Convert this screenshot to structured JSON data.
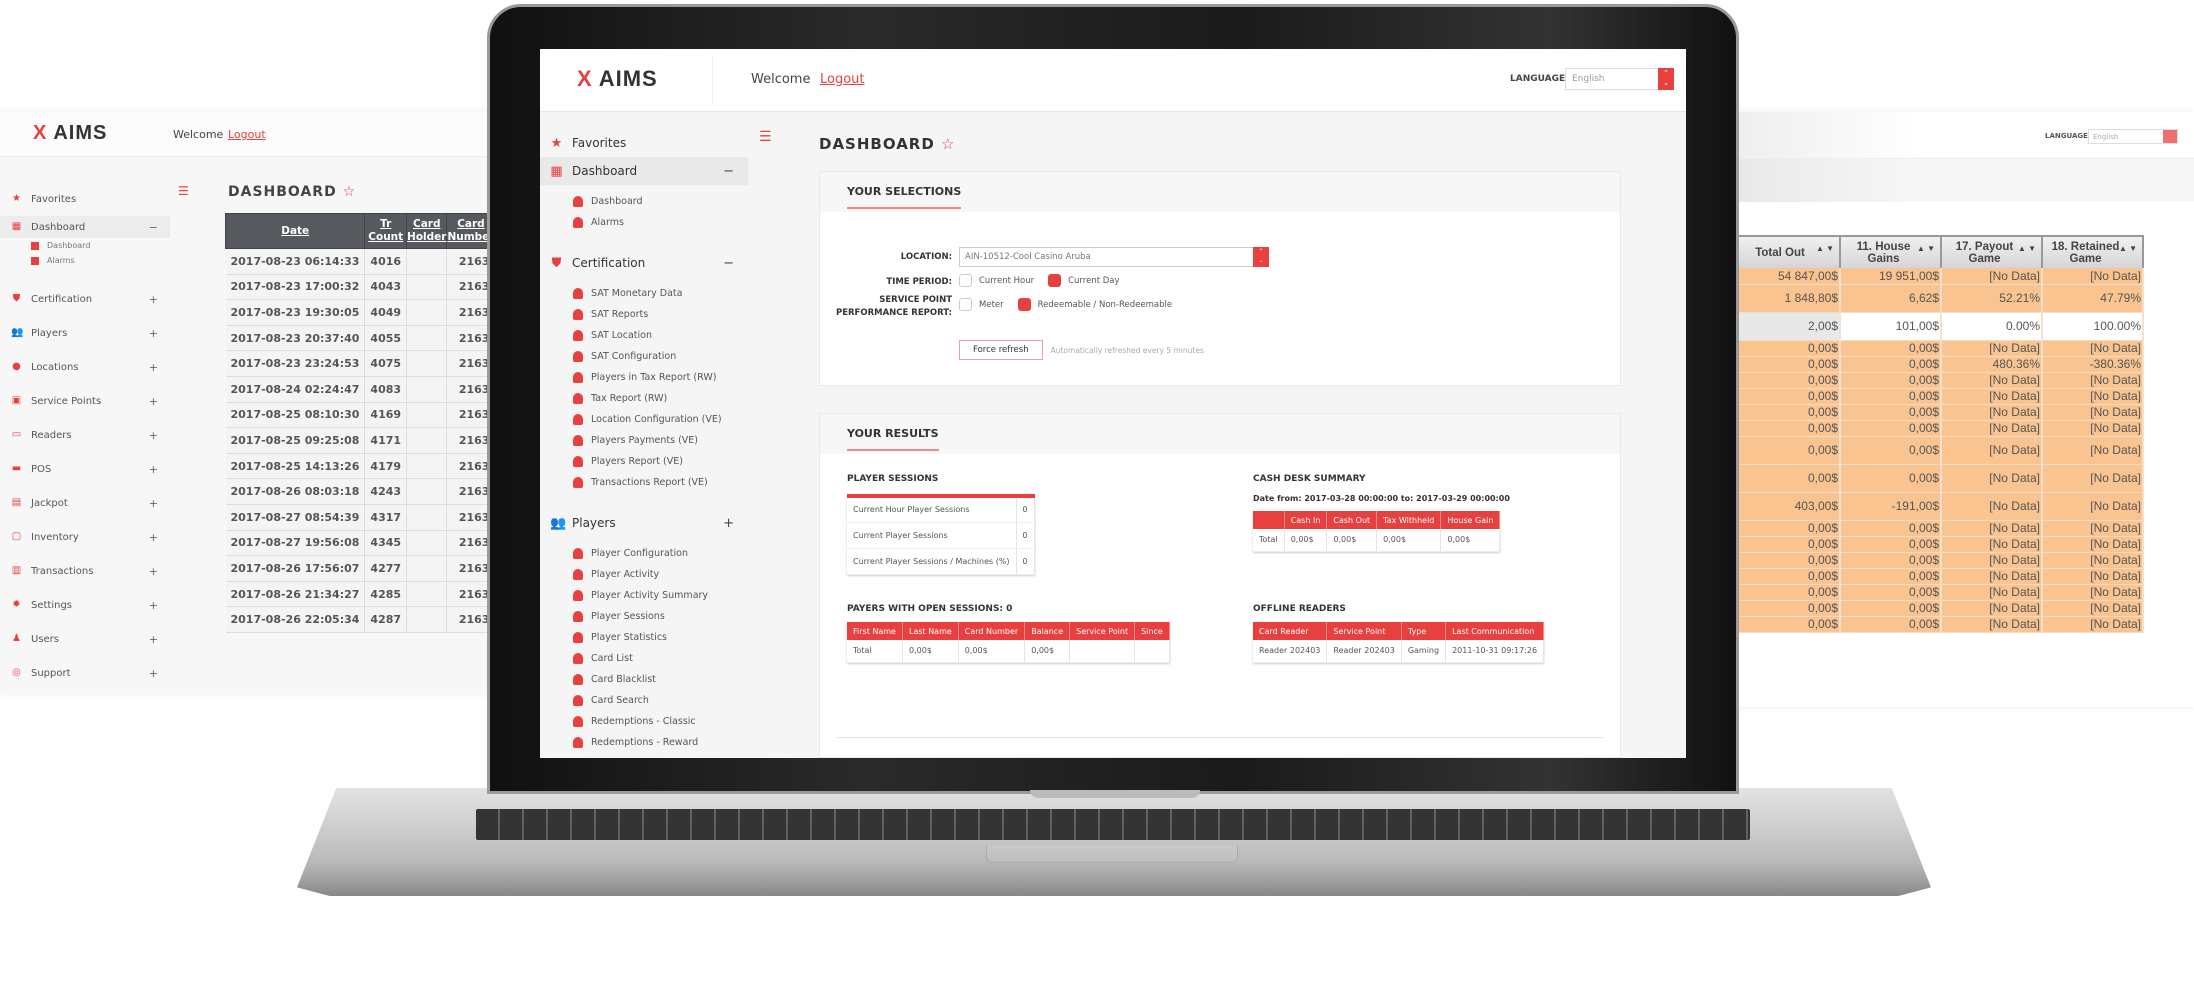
{
  "colors": {
    "accent": "#e8403f",
    "table_header_dark": "#565a5e",
    "row_highlight": "#f9c48f"
  },
  "brand": {
    "logo_mark": "X",
    "logo_text": "AIMS"
  },
  "header": {
    "welcome": "Welcome",
    "logout": "Logout",
    "language_label": "LANGUAGE",
    "language_value": "English"
  },
  "left_panel": {
    "sidebar": [
      {
        "label": "Favorites",
        "icon": "star-icon",
        "glyph": "★",
        "toggle": ""
      },
      {
        "label": "Dashboard",
        "icon": "dashboard-icon",
        "glyph": "▦",
        "toggle": "−",
        "active": true,
        "children": [
          "Dashboard",
          "Alarms"
        ]
      },
      {
        "label": "Certification",
        "icon": "shield-icon",
        "glyph": "⛊",
        "toggle": "+"
      },
      {
        "label": "Players",
        "icon": "players-icon",
        "glyph": "👥",
        "toggle": "+"
      },
      {
        "label": "Locations",
        "icon": "map-pin-icon",
        "glyph": "●",
        "toggle": "+"
      },
      {
        "label": "Service Points",
        "icon": "service-point-icon",
        "glyph": "▣",
        "toggle": "+"
      },
      {
        "label": "Readers",
        "icon": "card-reader-icon",
        "glyph": "▭",
        "toggle": "+"
      },
      {
        "label": "POS",
        "icon": "pos-icon",
        "glyph": "▬",
        "toggle": "+"
      },
      {
        "label": "Jackpot",
        "icon": "jackpot-icon",
        "glyph": "▤",
        "toggle": "+"
      },
      {
        "label": "Inventory",
        "icon": "clipboard-icon",
        "glyph": "▢",
        "toggle": "+"
      },
      {
        "label": "Transactions",
        "icon": "book-icon",
        "glyph": "▥",
        "toggle": "+"
      },
      {
        "label": "Settings",
        "icon": "gear-icon",
        "glyph": "✹",
        "toggle": "+"
      },
      {
        "label": "Users",
        "icon": "users-icon",
        "glyph": "♟",
        "toggle": "+"
      },
      {
        "label": "Support",
        "icon": "headset-icon",
        "glyph": "◎",
        "toggle": "+"
      }
    ],
    "title": "DASHBOARD",
    "table": {
      "columns": [
        "Date",
        "Tr Count",
        "Card Holder",
        "Card Number"
      ],
      "rows": [
        [
          "2017-08-23 06:14:33",
          "4016",
          "",
          "2163"
        ],
        [
          "2017-08-23 17:00:32",
          "4043",
          "",
          "2163"
        ],
        [
          "2017-08-23 19:30:05",
          "4049",
          "",
          "2163"
        ],
        [
          "2017-08-23 20:37:40",
          "4055",
          "",
          "2163"
        ],
        [
          "2017-08-23 23:24:53",
          "4075",
          "",
          "2163"
        ],
        [
          "2017-08-24 02:24:47",
          "4083",
          "",
          "2163"
        ],
        [
          "2017-08-25 08:10:30",
          "4169",
          "",
          "2163"
        ],
        [
          "2017-08-25 09:25:08",
          "4171",
          "",
          "2163"
        ],
        [
          "2017-08-25 14:13:26",
          "4179",
          "",
          "2163"
        ],
        [
          "2017-08-26 08:03:18",
          "4243",
          "",
          "2163"
        ],
        [
          "2017-08-27 08:54:39",
          "4317",
          "",
          "2163"
        ],
        [
          "2017-08-27 19:56:08",
          "4345",
          "",
          "2163"
        ],
        [
          "2017-08-26 17:56:07",
          "4277",
          "",
          "2163"
        ],
        [
          "2017-08-26 21:34:27",
          "4285",
          "",
          "2163"
        ],
        [
          "2017-08-26 22:05:34",
          "4287",
          "",
          "2163"
        ]
      ]
    }
  },
  "right_panel": {
    "table": {
      "columns": [
        "Total Out",
        "11. House Gains",
        "17. Payout Game",
        "18. Retained Game"
      ],
      "rows": [
        [
          "54 847,00$",
          "19 951,00$",
          "[No Data]",
          "[No Data]"
        ],
        [
          "1 848,80$",
          "6,62$",
          "52.21%",
          "47.79%"
        ],
        [
          "2,00$",
          "101,00$",
          "0.00%",
          "100.00%"
        ],
        [
          "0,00$",
          "0,00$",
          "[No Data]",
          "[No Data]"
        ],
        [
          "0,00$",
          "0,00$",
          "480.36%",
          "-380.36%"
        ],
        [
          "0,00$",
          "0,00$",
          "[No Data]",
          "[No Data]"
        ],
        [
          "0,00$",
          "0,00$",
          "[No Data]",
          "[No Data]"
        ],
        [
          "0,00$",
          "0,00$",
          "[No Data]",
          "[No Data]"
        ],
        [
          "0,00$",
          "0,00$",
          "[No Data]",
          "[No Data]"
        ],
        [
          "0,00$",
          "0,00$",
          "[No Data]",
          "[No Data]"
        ],
        [
          "0,00$",
          "0,00$",
          "[No Data]",
          "[No Data]"
        ],
        [
          "403,00$",
          "-191,00$",
          "[No Data]",
          "[No Data]"
        ],
        [
          "0,00$",
          "0,00$",
          "[No Data]",
          "[No Data]"
        ],
        [
          "0,00$",
          "0,00$",
          "[No Data]",
          "[No Data]"
        ],
        [
          "0,00$",
          "0,00$",
          "[No Data]",
          "[No Data]"
        ],
        [
          "0,00$",
          "0,00$",
          "[No Data]",
          "[No Data]"
        ],
        [
          "0,00$",
          "0,00$",
          "[No Data]",
          "[No Data]"
        ],
        [
          "0,00$",
          "0,00$",
          "[No Data]",
          "[No Data]"
        ],
        [
          "0,00$",
          "0,00$",
          "[No Data]",
          "[No Data]"
        ]
      ]
    }
  },
  "screen": {
    "sidebar": [
      {
        "label": "Favorites",
        "icon": "star-icon",
        "glyph": "★",
        "toggle": "",
        "children": []
      },
      {
        "label": "Dashboard",
        "icon": "dashboard-icon",
        "glyph": "▦",
        "toggle": "−",
        "active": true,
        "children": [
          "Dashboard",
          "Alarms"
        ]
      },
      {
        "label": "Certification",
        "icon": "shield-icon",
        "glyph": "⛊",
        "toggle": "−",
        "children": [
          "SAT Monetary Data",
          "SAT Reports",
          "SAT Location",
          "SAT Configuration",
          "Players in Tax Report (RW)",
          "Tax Report (RW)",
          "Location Configuration (VE)",
          "Players Payments (VE)",
          "Players Report (VE)",
          "Transactions Report (VE)"
        ]
      },
      {
        "label": "Players",
        "icon": "players-icon",
        "glyph": "👥",
        "toggle": "+",
        "children": [
          "Player Configuration",
          "Player Activity",
          "Player Activity Summary",
          "Player Sessions",
          "Player Statistics",
          "Card List",
          "Card Blacklist",
          "Card Search",
          "Redemptions - Classic",
          "Redemptions - Reward"
        ]
      }
    ],
    "title": "DASHBOARD",
    "selections": {
      "heading": "YOUR SELECTIONS",
      "location_label": "LOCATION:",
      "location_value": "AIN-10512-Cool Casino Aruba",
      "time_period_label": "TIME PERIOD:",
      "time_options": [
        {
          "label": "Current Hour",
          "selected": false
        },
        {
          "label": "Current Day",
          "selected": true
        }
      ],
      "spr_label_1": "SERVICE POINT",
      "spr_label_2": "PERFORMANCE REPORT:",
      "spr_options": [
        {
          "label": "Meter",
          "selected": false
        },
        {
          "label": "Redeemable / Non-Redeemable",
          "selected": true
        }
      ],
      "refresh_button": "Force refresh",
      "refresh_hint": "Automatically refreshed every 5 minutes"
    },
    "results": {
      "heading": "YOUR RESULTS",
      "player_sessions": {
        "title": "PLAYER SESSIONS",
        "rows": [
          [
            "Current Hour Player Sessions",
            "0"
          ],
          [
            "Current Player Sessions",
            "0"
          ],
          [
            "Current Player Sessions / Machines (%)",
            "0"
          ]
        ]
      },
      "cash_desk": {
        "title": "CASH DESK SUMMARY",
        "date_range": "Date from: 2017-03-28 00:00:00 to: 2017-03-29 00:00:00",
        "columns": [
          "",
          "Cash In",
          "Cash Out",
          "Tax Withheld",
          "House Gain"
        ],
        "rows": [
          [
            "Total",
            "0,00$",
            "0,00$",
            "0,00$",
            "0,00$"
          ]
        ]
      },
      "open_sessions": {
        "title": "PAYERS WITH OPEN SESSIONS: 0",
        "columns": [
          "First Name",
          "Last Name",
          "Card Number",
          "Balance",
          "Service Point",
          "Since"
        ],
        "rows": [
          [
            "Total",
            "0,00$",
            "0,00$",
            "0,00$",
            "",
            ""
          ]
        ]
      },
      "offline_readers": {
        "title": "OFFLINE READERS",
        "columns": [
          "Card Reader",
          "Service Point",
          "Type",
          "Last Communication"
        ],
        "rows": [
          [
            "Reader 202403",
            "Reader 202403",
            "Gaming",
            "2011-10-31 09:17:26"
          ]
        ]
      }
    }
  }
}
